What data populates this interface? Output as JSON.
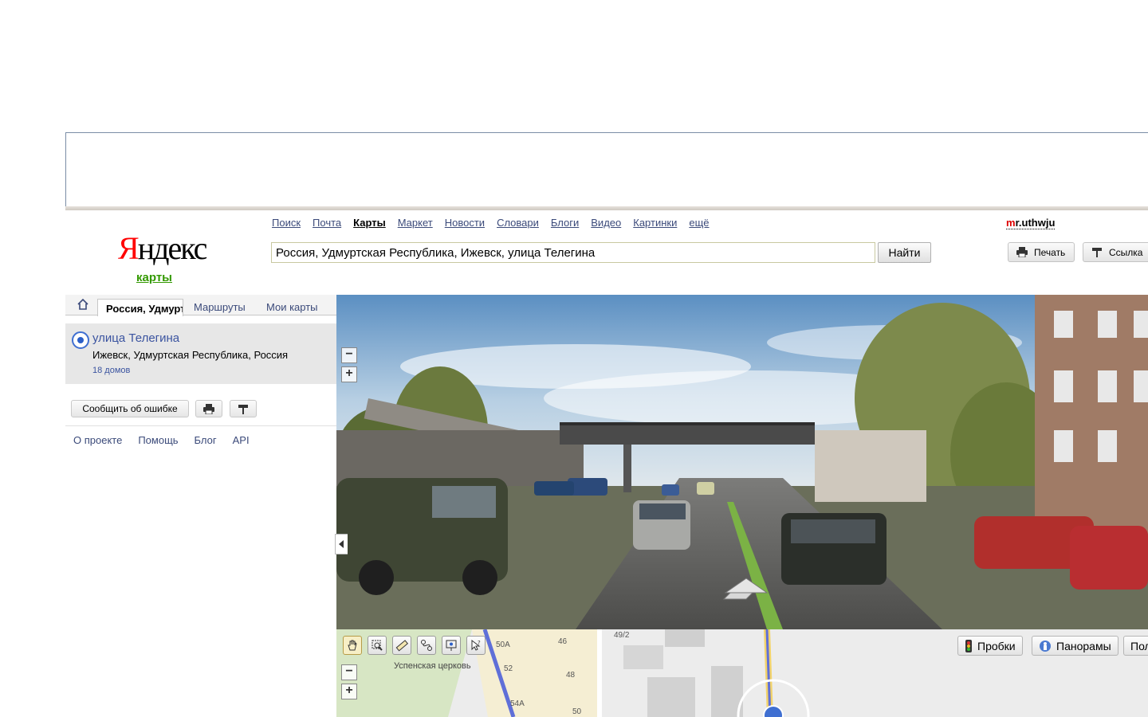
{
  "services": [
    "Поиск",
    "Почта",
    "Карты",
    "Маркет",
    "Новости",
    "Словари",
    "Блоги",
    "Видео",
    "Картинки",
    "ещё"
  ],
  "active_service": "Карты",
  "user": {
    "first": "m",
    "rest": "r.uthwju"
  },
  "logo": {
    "first": "Я",
    "rest": "ндекс",
    "sub": "карты"
  },
  "search": {
    "value": "Россия, Удмуртская Республика, Ижевск, улица Телегина",
    "button": "Найти"
  },
  "toolbar": {
    "print": "Печать",
    "link": "Ссылка"
  },
  "tabs": {
    "active": "Россия, Удмуртская Республика, Ижевск, улица Телегина",
    "routes": "Маршруты",
    "mymaps": "Мои карты"
  },
  "result": {
    "title": "улица Телегина",
    "address": "Ижевск, Удмуртская Республика, Россия",
    "count": "18 домов"
  },
  "report_button": "Сообщить об ошибке",
  "footer_links": [
    "О проекте",
    "Помощь",
    "Блог",
    "API"
  ],
  "map": {
    "layers": [
      "Пробки",
      "Панорамы",
      "Пол"
    ],
    "labels": [
      "50А",
      "52",
      "54А",
      "46",
      "48",
      "50",
      "49/2",
      "Успенская церковь"
    ]
  }
}
